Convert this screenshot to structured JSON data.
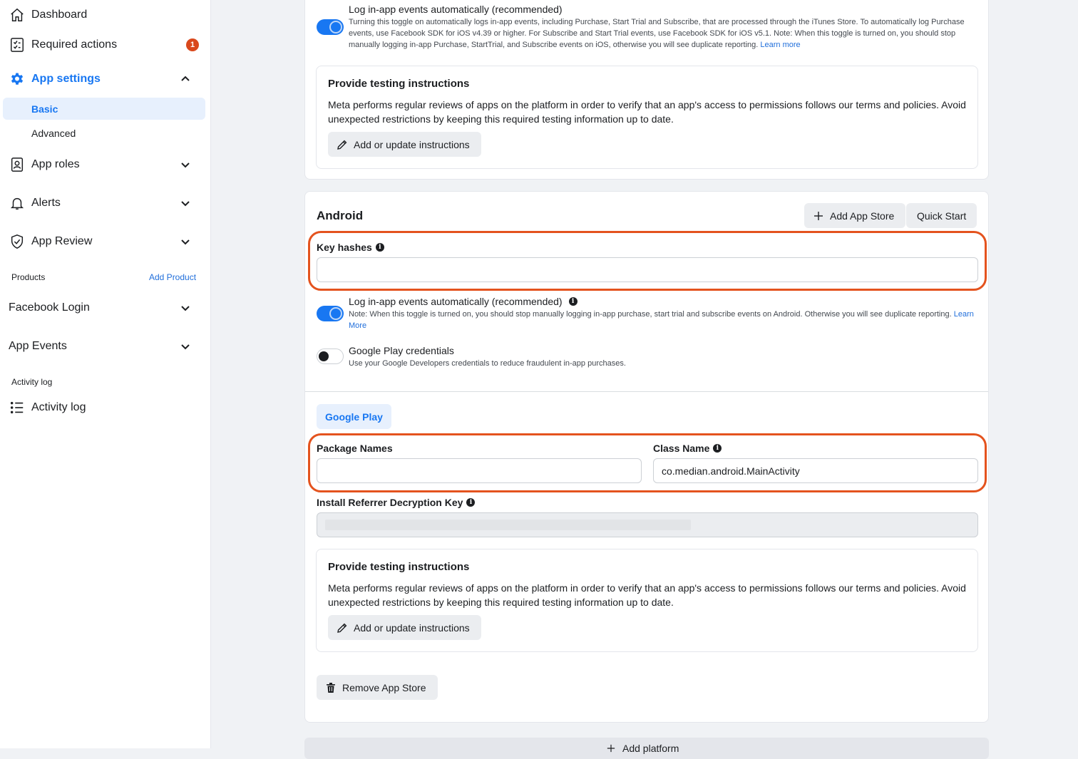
{
  "sidebar": {
    "dashboard": "Dashboard",
    "required_actions": "Required actions",
    "required_actions_count": "1",
    "app_settings": "App settings",
    "basic": "Basic",
    "advanced": "Advanced",
    "app_roles": "App roles",
    "alerts": "Alerts",
    "app_review": "App Review",
    "products_section": "Products",
    "add_product": "Add Product",
    "facebook_login": "Facebook Login",
    "app_events": "App Events",
    "activity_section": "Activity log",
    "activity_log": "Activity log"
  },
  "ios": {
    "log_events_title": "Log in-app events automatically (recommended)",
    "log_events_desc": "Turning this toggle on automatically logs in-app events, including Purchase, Start Trial and Subscribe, that are processed through the iTunes Store. To automatically log Purchase events, use Facebook SDK for iOS v4.39 or higher. For Subscribe and Start Trial events, use Facebook SDK for iOS v5.1. Note: When this toggle is turned on, you should stop manually logging in-app Purchase, StartTrial, and Subscribe events on iOS, otherwise you will see duplicate reporting.",
    "learn_more": "Learn more",
    "testing_title": "Provide testing instructions",
    "testing_text": "Meta performs regular reviews of apps on the platform in order to verify that an app's access to permissions follows our terms and policies. Avoid unexpected restrictions by keeping this required testing information up to date.",
    "testing_button": "Add or update instructions"
  },
  "android": {
    "title": "Android",
    "add_app_store": "Add App Store",
    "quick_start": "Quick Start",
    "key_hashes_label": "Key hashes",
    "key_hashes_value": "",
    "log_events_title": "Log in-app events automatically (recommended)",
    "log_events_desc": "Note: When this toggle is turned on, you should stop manually logging in-app purchase, start trial and subscribe events on Android. Otherwise you will see duplicate reporting.",
    "learn_more": "Learn More",
    "google_play_creds_title": "Google Play credentials",
    "google_play_creds_desc": "Use your Google Developers credentials to reduce fraudulent in-app purchases.",
    "google_play_tab": "Google Play",
    "package_names_label": "Package Names",
    "package_names_value": "",
    "class_name_label": "Class Name",
    "class_name_value": "co.median.android.MainActivity",
    "install_referrer_label": "Install Referrer Decryption Key",
    "testing_title": "Provide testing instructions",
    "testing_text": "Meta performs regular reviews of apps on the platform in order to verify that an app's access to permissions follows our terms and policies. Avoid unexpected restrictions by keeping this required testing information up to date.",
    "testing_button": "Add or update instructions",
    "remove_app_store": "Remove App Store"
  },
  "footer": {
    "add_platform": "Add platform"
  },
  "colors": {
    "accent": "#1877f2",
    "highlight": "#e4531e",
    "badge": "#d9481c"
  }
}
